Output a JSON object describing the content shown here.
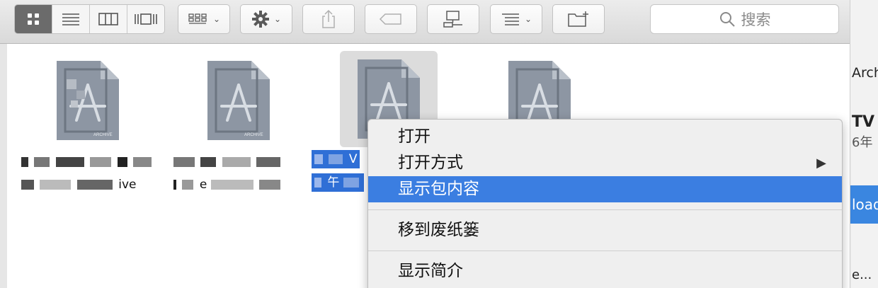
{
  "toolbar": {
    "view_modes": [
      {
        "icon": "icon-view-icon",
        "active": true
      },
      {
        "icon": "list-view-icon",
        "active": false
      },
      {
        "icon": "column-view-icon",
        "active": false
      },
      {
        "icon": "coverflow-view-icon",
        "active": false
      }
    ],
    "arrange_icon": "arrange-grid-icon",
    "action_icon": "gear-icon",
    "share_icon": "share-icon",
    "tags_icon": "tag-icon",
    "connect_icon": "connect-server-icon",
    "sort_icon": "sort-list-icon",
    "new_folder_icon": "new-folder-icon",
    "search_placeholder": "搜索"
  },
  "files": [
    {
      "name_line1": "",
      "name_line2": "ive",
      "selected": false,
      "badge": "ARCHIVE"
    },
    {
      "name_line1": "",
      "name_line2": "e",
      "selected": false,
      "badge": "ARCHIVE"
    },
    {
      "name_line1": "V",
      "name_line2": "午",
      "selected": true,
      "badge": ""
    },
    {
      "name_line1": "",
      "name_line2": "",
      "selected": false,
      "badge": ""
    }
  ],
  "context_menu": {
    "items": [
      {
        "label": "打开",
        "highlighted": false,
        "submenu": false
      },
      {
        "label": "打开方式",
        "highlighted": false,
        "submenu": true
      },
      {
        "label": "显示包内容",
        "highlighted": true,
        "submenu": false
      },
      {
        "label": "移到废纸篓",
        "highlighted": false,
        "submenu": false
      },
      {
        "label": "显示简介",
        "highlighted": false,
        "submenu": false
      }
    ],
    "submenu_arrow": "▶"
  },
  "side_panel": {
    "text1": "Arch",
    "text2": "TV",
    "text3": "6年",
    "button_text": "load",
    "text4": "e..."
  },
  "colors": {
    "menu_highlight": "#3b7ee1",
    "selection": "#2f6fd6",
    "icon_gray": "#8d96a3"
  }
}
